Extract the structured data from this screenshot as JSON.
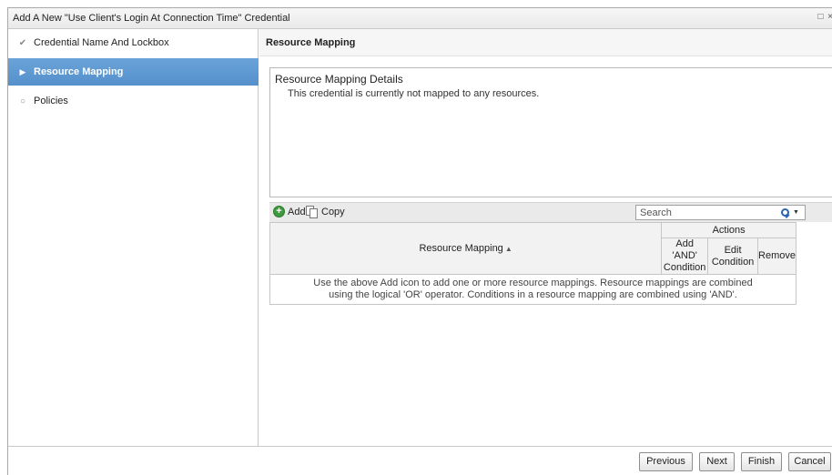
{
  "window": {
    "title": "Add A New \"Use Client's Login At Connection Time\" Credential",
    "controls": [
      "□",
      "×"
    ]
  },
  "sidebar": {
    "items": [
      {
        "label": "Credential Name And Lockbox",
        "icon": "check-icon",
        "glyph": "✔",
        "state": "completed"
      },
      {
        "label": "Resource Mapping",
        "icon": "arrow-right-icon",
        "glyph": "▶",
        "state": "active"
      },
      {
        "label": "Policies",
        "icon": "circle-icon",
        "glyph": "○",
        "state": "pending"
      }
    ]
  },
  "main": {
    "section_title": "Resource Mapping",
    "details": {
      "title": "Resource Mapping Details",
      "text": "This credential is currently not mapped to any resources."
    },
    "toolbar": {
      "add_label": "Add",
      "copy_label": "Copy",
      "search_placeholder": "Search"
    },
    "grid": {
      "columns": {
        "resource_mapping": "Resource Mapping",
        "actions": "Actions",
        "add_and_line1": "Add 'AND'",
        "add_and_line2": "Condition",
        "edit_line1": "Edit",
        "edit_line2": "Condition",
        "remove": "Remove"
      },
      "empty_line1": "Use the above Add icon to add one or more resource mappings. Resource mappings are combined",
      "empty_line2": "using the logical 'OR' operator. Conditions in a resource mapping are combined using 'AND'."
    }
  },
  "footer": {
    "previous": "Previous",
    "next": "Next",
    "finish": "Finish",
    "cancel": "Cancel"
  },
  "colors": {
    "active_nav": "#5b9bd5",
    "add_icon": "#3d9a3d",
    "search_icon": "#2a63b0"
  }
}
